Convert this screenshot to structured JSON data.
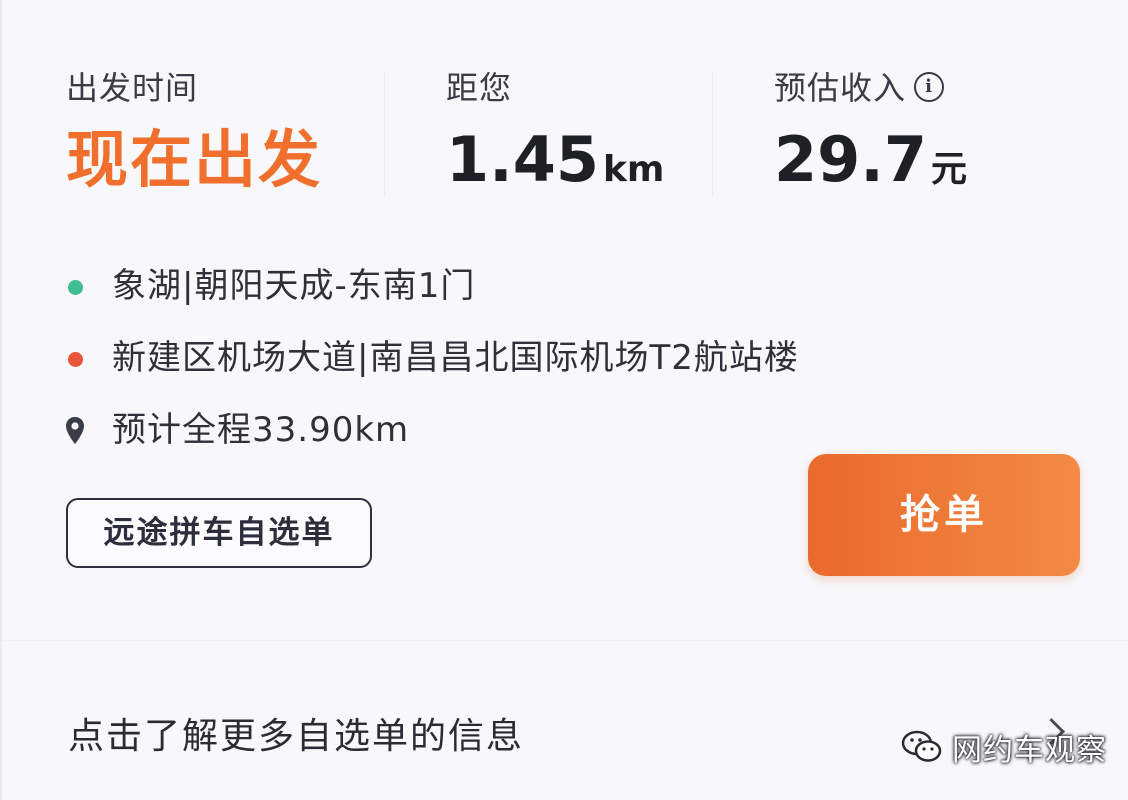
{
  "stats": {
    "departure": {
      "label": "出发时间",
      "value": "现在出发"
    },
    "distance": {
      "label": "距您",
      "value": "1.45",
      "unit": "km"
    },
    "income": {
      "label": "预估收入",
      "value": "29.7",
      "unit": "元",
      "info_icon_glyph": "i"
    }
  },
  "route": {
    "origin": {
      "text": "象湖|朝阳天成-东南1门",
      "dot_color": "#3fbf8f"
    },
    "destination": {
      "text": "新建区机场大道|南昌昌北国际机场T2航站楼",
      "dot_color": "#e8553a"
    },
    "total": {
      "text": "预计全程33.90km"
    }
  },
  "buttons": {
    "tag_label": "远途拼车自选单",
    "grab_label": "抢单"
  },
  "footer": {
    "more_info": "点击了解更多自选单的信息",
    "watermark": "网约车观察"
  },
  "colors": {
    "accent_orange": "#f06f2c",
    "button_gradient_start": "#ea6a2c",
    "button_gradient_end": "#f38a45",
    "text_dark": "#1f2025"
  },
  "icons": {
    "info": "info-circle-icon",
    "origin": "green-dot-icon",
    "destination": "red-dot-icon",
    "total": "location-pin-icon",
    "more": "chevron-right-icon",
    "watermark": "wechat-icon"
  }
}
